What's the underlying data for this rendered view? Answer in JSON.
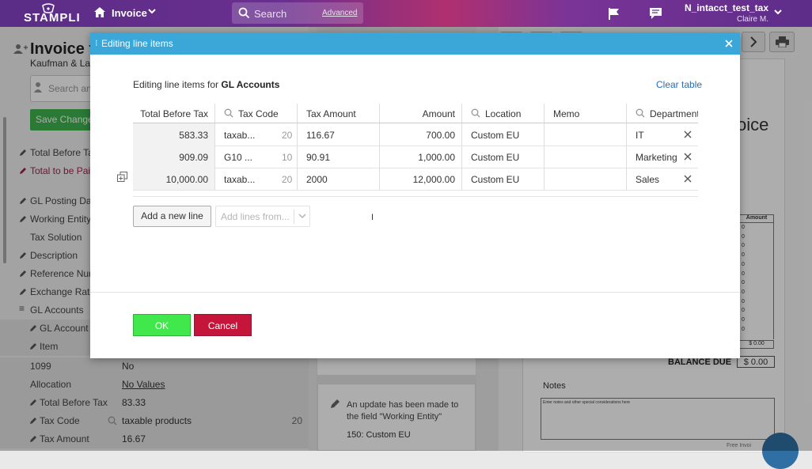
{
  "topbar": {
    "logo": "STAMPLI",
    "section": "Invoice",
    "search_placeholder": "Search",
    "search_advanced": "Advanced",
    "account_name": "N_intacct_test_tax",
    "user_name": "Claire M."
  },
  "background": {
    "title": "Invoice t",
    "subtitle": "Kaufman & Lang",
    "search_placeholder": "Search an",
    "save_button": "Save Change",
    "fields": [
      {
        "label": "Total Before Tax",
        "value": ""
      },
      {
        "label": "Total to be Paid",
        "value": ""
      },
      {
        "label": "GL Posting Date",
        "value": ""
      },
      {
        "label": "Working Entity",
        "value": ""
      },
      {
        "label": "Tax Solution",
        "value": ""
      },
      {
        "label": "Description",
        "value": ""
      },
      {
        "label": "Reference Numb",
        "value": ""
      },
      {
        "label": "Exchange Rate",
        "value": ""
      },
      {
        "label": "GL Accounts",
        "value": ""
      },
      {
        "label": "GL Account",
        "value": ""
      },
      {
        "label": "Item",
        "value": ""
      },
      {
        "label": "1099",
        "value": "No"
      },
      {
        "label": "Allocation",
        "value": "No Values"
      },
      {
        "label": "Total Before Tax",
        "value": "83.33"
      },
      {
        "label": "Tax Code",
        "value": "taxable products",
        "extra": "20"
      },
      {
        "label": "Tax Amount",
        "value": "16.67"
      }
    ],
    "update_note": "An update has been made to the field \"Working Entity\"",
    "update_value": "150: Custom EU",
    "invoice_word": "oice",
    "amount_header": "Amount",
    "amount_values": [
      "0",
      "0",
      "0",
      "0",
      "0",
      "0",
      "0",
      "0",
      "0",
      "0",
      "0",
      "0"
    ],
    "small_total": "$ 0.00",
    "balance_due_label": "BALANCE DUE",
    "balance_due_value": "$ 0.00",
    "notes_label": "Notes",
    "notes_placeholder": "Enter notes and other special considerations here",
    "free_invoice": "Free Invoi"
  },
  "modal": {
    "title": "Editing line items",
    "caption_prefix": "Editing line items for ",
    "caption_bold": "GL Accounts",
    "clear_table": "Clear table",
    "columns": [
      "Total Before Tax",
      "Tax Code",
      "Tax Amount",
      "Amount",
      "Location",
      "Memo",
      "Department"
    ],
    "rows": [
      {
        "total_before_tax": "583.33",
        "tax_code": "taxab...",
        "tax_code_num": "20",
        "tax_amount": "116.67",
        "amount": "700.00",
        "location": "Custom EU",
        "memo": "",
        "department": "IT"
      },
      {
        "total_before_tax": "909.09",
        "tax_code": "G10 ...",
        "tax_code_num": "10",
        "tax_amount": "90.91",
        "amount": "1,000.00",
        "location": "Custom EU",
        "memo": "",
        "department": "Marketing"
      },
      {
        "total_before_tax": "10,000.00",
        "tax_code": "taxab...",
        "tax_code_num": "20",
        "tax_amount": "2000",
        "amount": "12,000.00",
        "location": "Custom EU",
        "memo": "",
        "department": "Sales"
      }
    ],
    "add_line": "Add a new line",
    "add_from": "Add lines from...",
    "ok": "OK",
    "cancel": "Cancel"
  },
  "colors": {
    "header_blue": "#3aa7d8",
    "ok_green": "#41e84b",
    "cancel_red": "#c6153b",
    "save_green": "#3fb34f"
  }
}
